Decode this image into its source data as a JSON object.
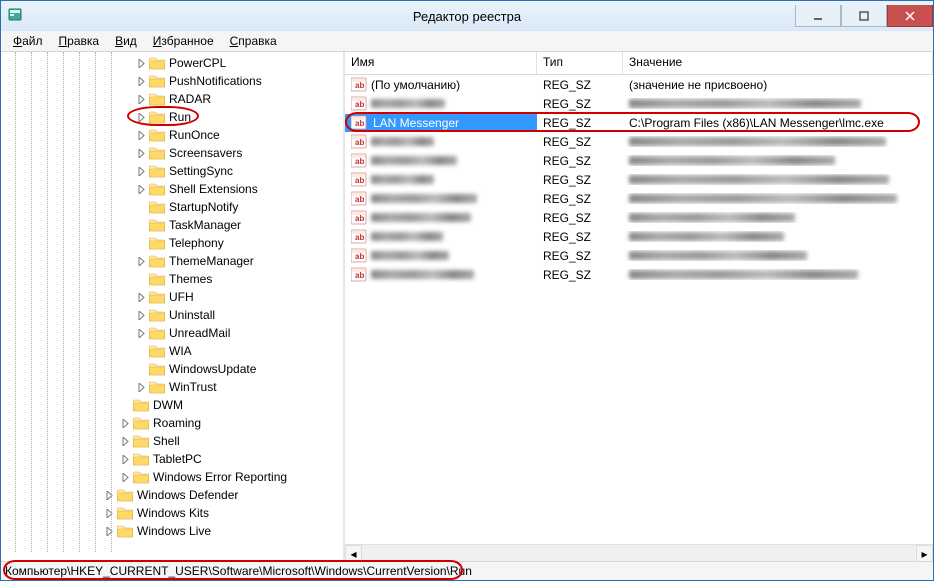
{
  "window": {
    "title": "Редактор реестра"
  },
  "menu": {
    "file": "Файл",
    "edit": "Правка",
    "view": "Вид",
    "favorites": "Избранное",
    "help": "Справка"
  },
  "tree": {
    "items": [
      {
        "indent": 8,
        "expander": "right",
        "label": "PowerCPL"
      },
      {
        "indent": 8,
        "expander": "right",
        "label": "PushNotifications"
      },
      {
        "indent": 8,
        "expander": "right",
        "label": "RADAR"
      },
      {
        "indent": 8,
        "expander": "right",
        "label": "Run",
        "highlighted": true
      },
      {
        "indent": 8,
        "expander": "right",
        "label": "RunOnce"
      },
      {
        "indent": 8,
        "expander": "right",
        "label": "Screensavers"
      },
      {
        "indent": 8,
        "expander": "right",
        "label": "SettingSync"
      },
      {
        "indent": 8,
        "expander": "right",
        "label": "Shell Extensions"
      },
      {
        "indent": 8,
        "expander": "none",
        "label": "StartupNotify"
      },
      {
        "indent": 8,
        "expander": "none",
        "label": "TaskManager"
      },
      {
        "indent": 8,
        "expander": "none",
        "label": "Telephony"
      },
      {
        "indent": 8,
        "expander": "right",
        "label": "ThemeManager"
      },
      {
        "indent": 8,
        "expander": "none",
        "label": "Themes"
      },
      {
        "indent": 8,
        "expander": "right",
        "label": "UFH"
      },
      {
        "indent": 8,
        "expander": "right",
        "label": "Uninstall"
      },
      {
        "indent": 8,
        "expander": "right",
        "label": "UnreadMail"
      },
      {
        "indent": 8,
        "expander": "none",
        "label": "WIA"
      },
      {
        "indent": 8,
        "expander": "none",
        "label": "WindowsUpdate"
      },
      {
        "indent": 8,
        "expander": "right",
        "label": "WinTrust"
      },
      {
        "indent": 7,
        "expander": "none",
        "label": "DWM"
      },
      {
        "indent": 7,
        "expander": "right",
        "label": "Roaming"
      },
      {
        "indent": 7,
        "expander": "right",
        "label": "Shell"
      },
      {
        "indent": 7,
        "expander": "right",
        "label": "TabletPC"
      },
      {
        "indent": 7,
        "expander": "right",
        "label": "Windows Error Reporting"
      },
      {
        "indent": 6,
        "expander": "right",
        "label": "Windows Defender"
      },
      {
        "indent": 6,
        "expander": "right",
        "label": "Windows Kits"
      },
      {
        "indent": 6,
        "expander": "right",
        "label": "Windows Live"
      }
    ]
  },
  "list": {
    "columns": {
      "name": "Имя",
      "type": "Тип",
      "value": "Значение"
    },
    "col_widths": {
      "name": 192,
      "type": 86,
      "value": 300
    },
    "rows": [
      {
        "name": "(По умолчанию)",
        "type": "REG_SZ",
        "value": "(значение не присвоено)",
        "blurred": false,
        "selected": false
      },
      {
        "name": "",
        "type": "REG_SZ",
        "value": "",
        "blurred": true,
        "selected": false
      },
      {
        "name": "LAN Messenger",
        "type": "REG_SZ",
        "value": "C:\\Program Files (x86)\\LAN Messenger\\lmc.exe",
        "blurred": false,
        "selected": true,
        "highlighted": true
      },
      {
        "name": "",
        "type": "REG_SZ",
        "value": "",
        "blurred": true,
        "selected": false
      },
      {
        "name": "",
        "type": "REG_SZ",
        "value": "",
        "blurred": true,
        "selected": false
      },
      {
        "name": "",
        "type": "REG_SZ",
        "value": "",
        "blurred": true,
        "selected": false
      },
      {
        "name": "",
        "type": "REG_SZ",
        "value": "",
        "blurred": true,
        "selected": false
      },
      {
        "name": "",
        "type": "REG_SZ",
        "value": "",
        "blurred": true,
        "selected": false
      },
      {
        "name": "",
        "type": "REG_SZ",
        "value": "",
        "blurred": true,
        "selected": false
      },
      {
        "name": "",
        "type": "REG_SZ",
        "value": "",
        "blurred": true,
        "selected": false
      },
      {
        "name": "",
        "type": "REG_SZ",
        "value": "",
        "blurred": true,
        "selected": false
      }
    ]
  },
  "statusbar": {
    "path": "Компьютер\\HKEY_CURRENT_USER\\Software\\Microsoft\\Windows\\CurrentVersion\\Run"
  }
}
